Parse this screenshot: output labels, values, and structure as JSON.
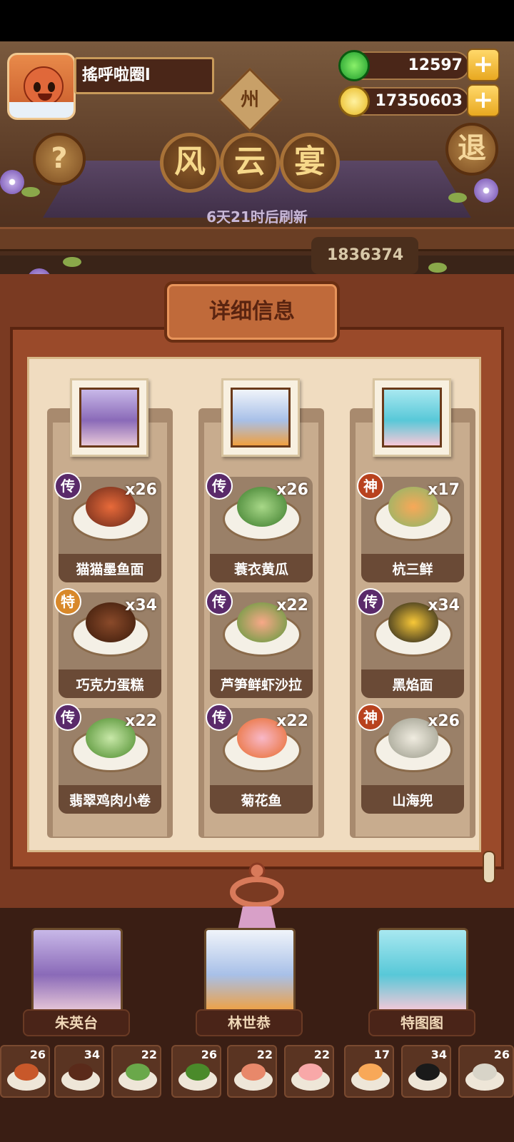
{
  "player": {
    "name": "搖呼啦圈l"
  },
  "currency": {
    "jade": "12597",
    "coins": "17350603"
  },
  "location_sign": "州",
  "title_chars": [
    "风",
    "云",
    "宴"
  ],
  "buttons": {
    "help": "?",
    "exit": "退"
  },
  "refresh_text": "6天21时后刷新",
  "score_text": "1836374",
  "panel_title": "详细信息",
  "columns": [
    {
      "dishes": [
        {
          "badge": "传",
          "count": "x26",
          "name": "猫猫墨鱼面"
        },
        {
          "badge": "特",
          "count": "x34",
          "name": "巧克力蛋糕"
        },
        {
          "badge": "传",
          "count": "x22",
          "name": "翡翠鸡肉小卷"
        }
      ]
    },
    {
      "dishes": [
        {
          "badge": "传",
          "count": "x26",
          "name": "蓑衣黄瓜"
        },
        {
          "badge": "传",
          "count": "x22",
          "name": "芦笋鲜虾沙拉"
        },
        {
          "badge": "传",
          "count": "x22",
          "name": "菊花鱼"
        }
      ]
    },
    {
      "dishes": [
        {
          "badge": "神",
          "count": "x17",
          "name": "杭三鲜"
        },
        {
          "badge": "传",
          "count": "x34",
          "name": "黑焰面"
        },
        {
          "badge": "神",
          "count": "x26",
          "name": "山海兜"
        }
      ]
    }
  ],
  "characters": [
    {
      "name": "朱英台"
    },
    {
      "name": "林世恭"
    },
    {
      "name": "特图图"
    }
  ],
  "mini_counts": [
    "26",
    "34",
    "22",
    "26",
    "22",
    "22",
    "17",
    "34",
    "26"
  ],
  "colors": {
    "badge_legend": "#5a2a6a",
    "badge_special": "#d8882a",
    "badge_divine": "#b8421e",
    "accent": "#c06a3a"
  }
}
